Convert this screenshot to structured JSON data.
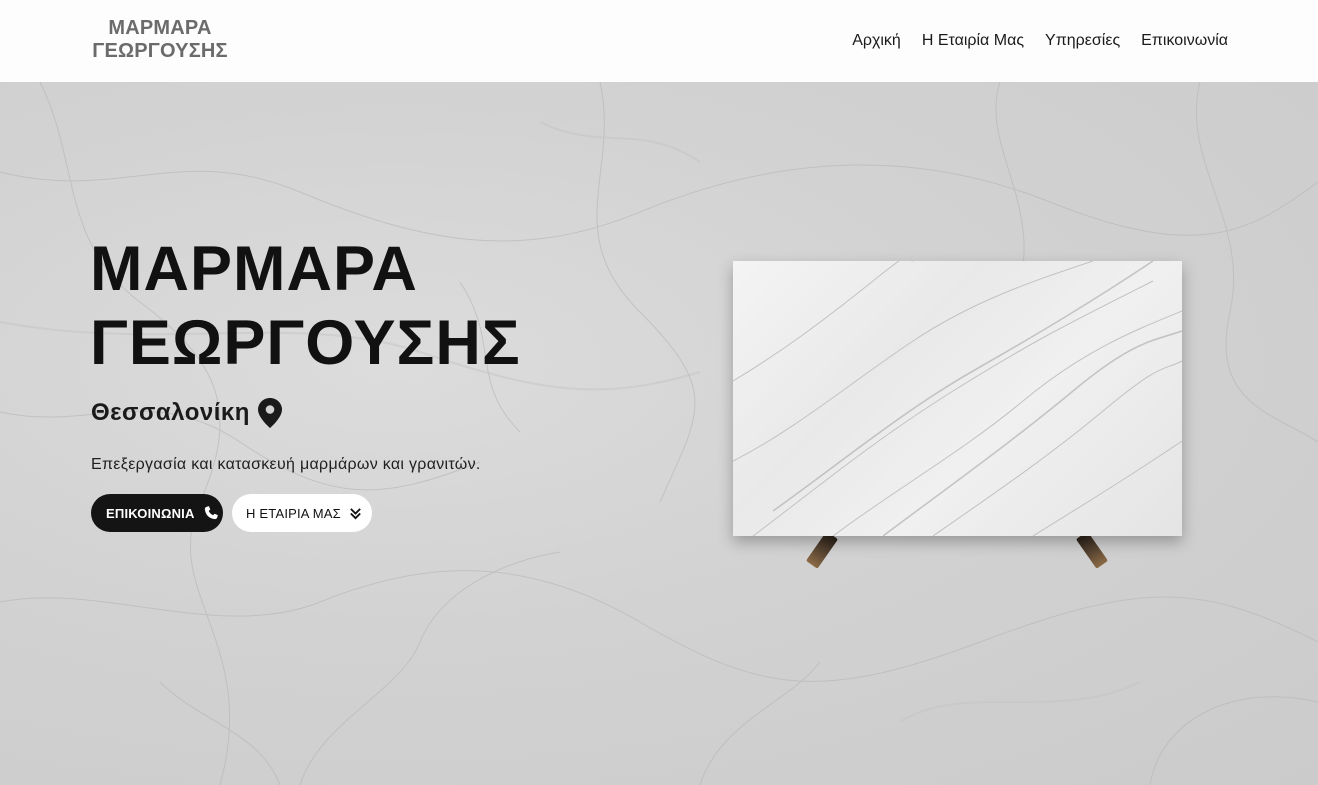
{
  "header": {
    "logo_line1": "ΜΑΡΜΑΡΑ",
    "logo_line2": "ΓΕΩΡΓΟΥΣΗΣ",
    "nav": [
      {
        "label": "Αρχική"
      },
      {
        "label": "Η Εταιρία Μας"
      },
      {
        "label": "Υπηρεσίες"
      },
      {
        "label": "Επικοινωνία"
      }
    ]
  },
  "hero": {
    "title_line1": "ΜΑΡΜΑΡΑ",
    "title_line2": "ΓΕΩΡΓΟΥΣΗΣ",
    "location": "Θεσσαλονίκη",
    "location_icon": "map-pin-icon",
    "tagline": "Επεξεργασία και κατασκευή μαρμάρων και γρανιτών.",
    "buttons": {
      "contact": {
        "label": "ΕΠΙΚΟΙΝΩΝΙΑ",
        "icon": "phone-icon"
      },
      "company": {
        "label": "Η ΕΤΑΙΡΙΑ ΜΑΣ",
        "icon": "double-chevron-down-icon"
      }
    }
  },
  "colors": {
    "header_bg": "#fdfdfd",
    "logo": "#6b6b6b",
    "text_dark": "#111111",
    "button_dark": "#141414",
    "button_light": "#ffffff",
    "marble_bg": "#d2d2d2"
  }
}
